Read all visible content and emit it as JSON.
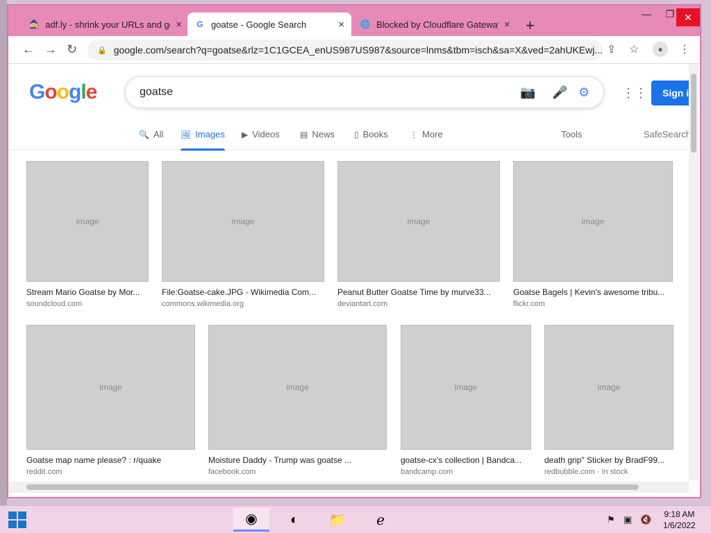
{
  "browser": {
    "tabs": [
      {
        "title": "adf.ly - shrink your URLs and get",
        "icon": "wizard-icon",
        "active": false
      },
      {
        "title": "goatse - Google Search",
        "icon": "google-g-icon",
        "active": true
      },
      {
        "title": "Blocked by Cloudflare Gateway",
        "icon": "globe-icon",
        "active": false
      }
    ],
    "url": "google.com/search?q=goatse&rlz=1C1GCEA_enUS987US987&source=lnms&tbm=isch&sa=X&ved=2ahUKEwj..."
  },
  "google": {
    "logo": "Google",
    "query": "goatse",
    "signin_label": "Sign in",
    "filters": [
      {
        "label": "All",
        "icon": "search-icon",
        "active": false
      },
      {
        "label": "Images",
        "icon": "image-icon",
        "active": true
      },
      {
        "label": "Videos",
        "icon": "play-icon",
        "active": false
      },
      {
        "label": "News",
        "icon": "news-icon",
        "active": false
      },
      {
        "label": "Books",
        "icon": "book-icon",
        "active": false
      },
      {
        "label": "More",
        "icon": "kebab-icon",
        "active": false
      }
    ],
    "tools_label": "Tools",
    "safesearch_label": "SafeSearch",
    "results": [
      {
        "caption": "Stream Mario Goatse by Mor...",
        "source": "soundcloud.com"
      },
      {
        "caption": "File:Goatse-cake.JPG - Wikimedia Com...",
        "source": "commons.wikimedia.org"
      },
      {
        "caption": "Peanut Butter Goatse Time by murve33...",
        "source": "deviantart.com"
      },
      {
        "caption": "Goatse Bagels | Kevin's awesome tribu...",
        "source": "flickr.com"
      },
      {
        "caption": "Goatse map name please? : r/quake",
        "source": "reddit.com"
      },
      {
        "caption": "Moisture Daddy - Trump was goatse ...",
        "source": "facebook.com"
      },
      {
        "caption": "goatse-cx's collection | Bandca...",
        "source": "bandcamp.com"
      },
      {
        "caption": "death grip\" Sticker by BradF99...",
        "source": "redbubble.com · In stock"
      }
    ]
  },
  "taskbar": {
    "time": "9:18 AM",
    "date": "1/6/2022"
  }
}
